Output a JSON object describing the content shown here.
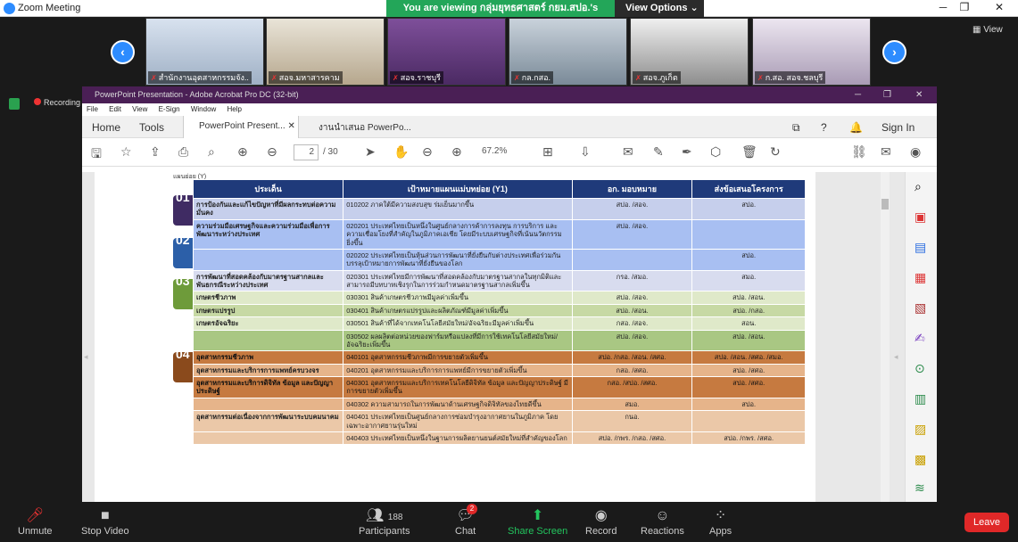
{
  "zoom": {
    "title": "Zoom Meeting",
    "banner_pre": "You are viewing ",
    "banner_name": "กลุ่มยุทธศาสตร์ กยม.สปอ.",
    "banner_post": "'s screen",
    "view_options": "View Options",
    "view": "View"
  },
  "participants": [
    {
      "label": "สำนักงานอุตสาหกรรมจัง.."
    },
    {
      "label": "สอจ.มหาสารคาม"
    },
    {
      "label": "สอจ.ราชบุรี"
    },
    {
      "label": "กล.กสอ."
    },
    {
      "label": "สอจ.ภูเก็ต"
    },
    {
      "label": "ก.สอ. สอจ.ชลบุรี"
    }
  ],
  "recording": "Recording",
  "acrobat": {
    "title": "PowerPoint Presentation - Adobe Acrobat Pro DC (32-bit)",
    "menu": [
      "File",
      "Edit",
      "View",
      "E-Sign",
      "Window",
      "Help"
    ],
    "nav": {
      "home": "Home",
      "tools": "Tools"
    },
    "tabs": [
      "PowerPoint Present...",
      "งานนำเสนอ PowerPo..."
    ],
    "sign_in": "Sign In",
    "page_current": "2",
    "page_total": "/ 30",
    "zoom": "67.2%"
  },
  "doc": {
    "year_label": "แผนย่อย (Y)",
    "headers": [
      "ประเด็น",
      "เป้าหมายแผนแม่บทย่อย (Y1)",
      "อก. มอบหมาย",
      "ส่งข้อเสนอโครงการ"
    ],
    "badges": [
      "01",
      "02",
      "03",
      "04"
    ],
    "rows": [
      {
        "cls": "lavender",
        "issue": "การป้องกันและแก้ไขปัญหาที่มีผลกระทบต่อความมั่นคง",
        "goal": "010202 ภาคใต้มีความสงบสุข ร่มเย็นมากขึ้น",
        "assign": "สปอ. /สอจ.",
        "propose": "สปอ."
      },
      {
        "cls": "blue",
        "issue": "ความร่วมมือเศรษฐกิจและความร่วมมือเพื่อการพัฒนาระหว่างประเทศ",
        "goal": "020201 ประเทศไทยเป็นหนึ่งในศูนย์กลางการค้าการลงทุน การบริการ และความเชื่อมโยงที่สำคัญในภูมิภาคเอเชีย โดยมีระบบเศรษฐกิจที่เน้นนวัตกรรมยิ่งขึ้น",
        "assign": "สปอ. /สอจ.",
        "propose": ""
      },
      {
        "cls": "blue",
        "issue": "",
        "goal": "020202 ประเทศไทยเป็นหุ้นส่วนการพัฒนาที่ยั่งยืนกับต่างประเทศเพื่อร่วมกันบรรลุเป้าหมายการพัฒนาที่ยั่งยืนของโลก",
        "assign": "",
        "propose": "สปอ."
      },
      {
        "cls": "grayp",
        "issue": "การพัฒนาที่สอดคล้องกับมาตรฐานสากลและพันธกรณีระหว่างประเทศ",
        "goal": "020301 ประเทศไทยมีการพัฒนาที่สอดคล้องกับมาตรฐานสากลในทุกมิติและสามารถมีบทบาทเชิงรุกในการร่วมกำหนดมาตรฐานสากลเพิ่มขึ้น",
        "assign": "กรอ. /สมอ.",
        "propose": "สมอ."
      },
      {
        "cls": "lg",
        "issue": "เกษตรชีวภาพ",
        "goal": "030301 สินค้าเกษตรชีวภาพมีมูลค่าเพิ่มขึ้น",
        "assign": "สปอ. /สอจ.",
        "propose": "สปอ. /สอน."
      },
      {
        "cls": "mg",
        "issue": "เกษตรแปรรูป",
        "goal": "030401 สินค้าเกษตรแปรรูปและผลิตภัณฑ์มีมูลค่าเพิ่มขึ้น",
        "assign": "สปอ. /สอน.",
        "propose": "สปอ. /กสอ."
      },
      {
        "cls": "lg",
        "issue": "เกษตรอัจฉริยะ",
        "goal": "030501 สินค้าที่ได้จากเทคโนโลยีสมัยใหม่/อัจฉริยะมีมูลค่าเพิ่มขึ้น",
        "assign": "กสอ. /สอจ.",
        "propose": "สอน."
      },
      {
        "cls": "dg",
        "issue": "",
        "goal": "030502 ผลผลิตต่อหน่วยของฟาร์มหรือแปลงที่มีการใช้เทคโนโลยีสมัยใหม่/อัจฉริยะเพิ่มขึ้น",
        "assign": "สปอ. /สอจ.",
        "propose": "สปอ. /สอน."
      },
      {
        "cls": "or",
        "issue": "อุตสาหกรรมชีวภาพ",
        "goal": "040101 อุตสาหกรรมชีวภาพมีการขยายตัวเพิ่มขึ้น",
        "assign": "สปอ. /กสอ. /สอน. /สศอ.",
        "propose": "สปอ. /สอน. /สศอ. /สมอ."
      },
      {
        "cls": "lo",
        "issue": "อุตสาหกรรมและบริการการแพทย์ครบวงจร",
        "goal": "040201 อุตสาหกรรมและบริการการแพทย์มีการขยายตัวเพิ่มขึ้น",
        "assign": "กสอ. /สศอ.",
        "propose": "สปอ. /สศอ."
      },
      {
        "cls": "or",
        "issue": "อุตสาหกรรมและบริการดิจิทัล ข้อมูล และปัญญาประดิษฐ์",
        "goal": "040301 อุตสาหกรรมและบริการเทคโนโลยีดิจิทัล ข้อมูล และปัญญาประดิษฐ์ มีการขยายตัวเพิ่มขึ้น",
        "assign": "กสอ. /สปอ. /สศอ.",
        "propose": "สปอ. /สศอ."
      },
      {
        "cls": "lo",
        "issue": "",
        "goal": "040302 ความสามารถในการพัฒนาด้านเศรษฐกิจดิจิทัลของไทยดีขึ้น",
        "assign": "สมอ.",
        "propose": "สปอ."
      },
      {
        "cls": "tan",
        "issue": "อุตสาหกรรมต่อเนื่องจากการพัฒนาระบบคมนาคม",
        "goal": "040401 ประเทศไทยเป็นศูนย์กลางการซ่อมบำรุงอากาศยานในภูมิภาค โดยเฉพาะอากาศยานรุ่นใหม่",
        "assign": "กนอ.",
        "propose": ""
      },
      {
        "cls": "tan",
        "issue": "",
        "goal": "040403 ประเทศไทยเป็นหนึ่งในฐานการผลิตยานยนต์สมัยใหม่ที่สำคัญของโลก",
        "assign": "สปอ. /กพร. /กสอ. /สศอ.",
        "propose": "สปอ. /กพร. /สศอ."
      }
    ]
  },
  "controls": {
    "unmute": "Unmute",
    "stop_video": "Stop Video",
    "participants": "Participants",
    "participant_count": "188",
    "chat": "Chat",
    "chat_count": "2",
    "share": "Share Screen",
    "record": "Record",
    "reactions": "Reactions",
    "apps": "Apps",
    "leave": "Leave"
  }
}
